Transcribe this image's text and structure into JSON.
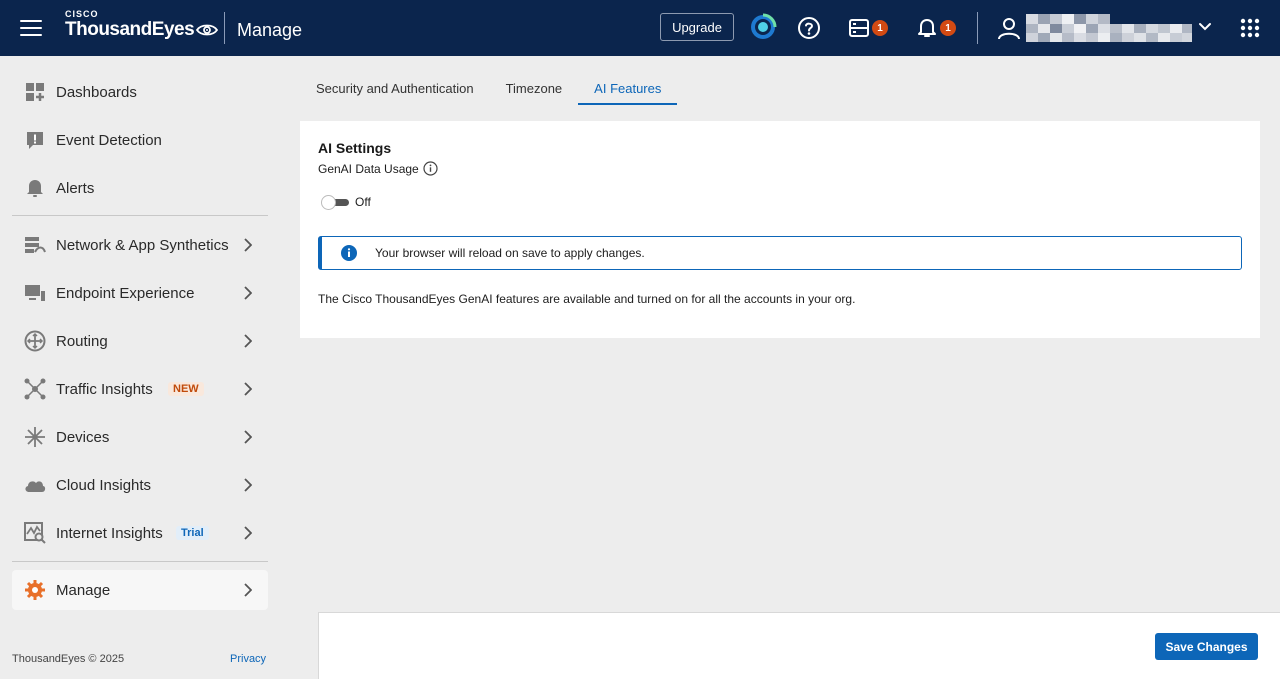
{
  "header": {
    "cisco_label": "CISCO",
    "brand_name": "ThousandEyes",
    "section_title": "Manage",
    "upgrade_label": "Upgrade",
    "tasks_badge": "1",
    "notifications_badge": "1",
    "icons": [
      "menu-icon",
      "eye-logo-icon",
      "assistant-icon",
      "help-icon",
      "tasks-icon",
      "bell-icon",
      "user-icon",
      "chevron-down-icon",
      "apps-grid-icon"
    ],
    "colors": {
      "background": "#0b254d",
      "badge": "#d24a13"
    }
  },
  "sidebar": {
    "items": [
      {
        "label": "Dashboards",
        "icon": "dashboards-icon",
        "chevron": false
      },
      {
        "label": "Event Detection",
        "icon": "alert-square-icon",
        "chevron": false
      },
      {
        "label": "Alerts",
        "icon": "bell-icon",
        "chevron": false
      },
      {
        "label": "Network & App Synthetics",
        "icon": "network-icon",
        "chevron": true
      },
      {
        "label": "Endpoint Experience",
        "icon": "endpoint-icon",
        "chevron": true
      },
      {
        "label": "Routing",
        "icon": "routing-icon",
        "chevron": true
      },
      {
        "label": "Traffic Insights",
        "icon": "traffic-icon",
        "chevron": true,
        "tag": "NEW"
      },
      {
        "label": "Devices",
        "icon": "devices-icon",
        "chevron": true
      },
      {
        "label": "Cloud Insights",
        "icon": "cloud-icon",
        "chevron": true
      },
      {
        "label": "Internet Insights",
        "icon": "internet-insights-icon",
        "chevron": true,
        "tag": "Trial"
      },
      {
        "label": "Manage",
        "icon": "gear-icon",
        "chevron": true,
        "active": true
      }
    ],
    "footer_copyright": "ThousandEyes © 2025",
    "footer_privacy": "Privacy"
  },
  "tabs": [
    {
      "label": "Security and Authentication",
      "active": false
    },
    {
      "label": "Timezone",
      "active": false
    },
    {
      "label": "AI Features",
      "active": true
    }
  ],
  "ai_settings": {
    "title": "AI Settings",
    "usage_label": "GenAI Data Usage",
    "toggle_state": "Off",
    "alert_message": "Your browser will reload on save to apply changes.",
    "description": "The Cisco ThousandEyes GenAI features are available and turned on for all the accounts in your org."
  },
  "footer": {
    "save_label": "Save Changes"
  },
  "accent_color": "#0d66b8"
}
